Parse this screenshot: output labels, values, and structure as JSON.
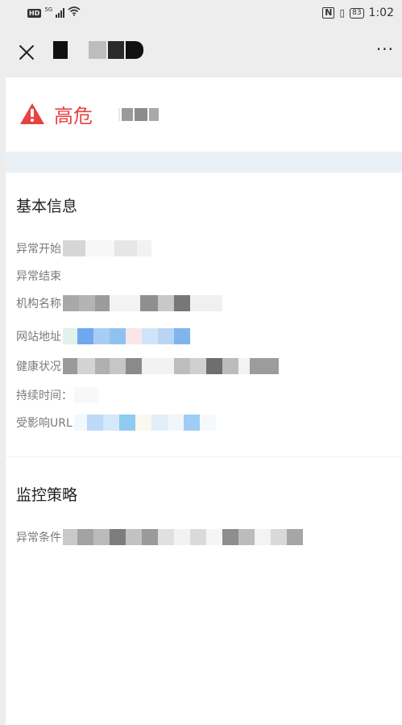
{
  "status_bar": {
    "hd": "HD",
    "signal": "5G",
    "battery": "83",
    "time": "1:02"
  },
  "title_bar": {
    "close_icon": "close-icon",
    "more_label": "···"
  },
  "alert": {
    "icon": "warning-triangle-icon",
    "level": "高危",
    "color": "#e64340"
  },
  "basic_info": {
    "title": "基本信息",
    "rows": [
      {
        "label": "异常开始"
      },
      {
        "label": "异常结束"
      },
      {
        "label": "机构名称"
      },
      {
        "label": "网站地址"
      },
      {
        "label": "健康状况"
      },
      {
        "label": "持续时间："
      },
      {
        "label": "受影响URL"
      }
    ]
  },
  "monitor_policy": {
    "title": "监控策略",
    "rows": [
      {
        "label": "异常条件"
      }
    ]
  }
}
